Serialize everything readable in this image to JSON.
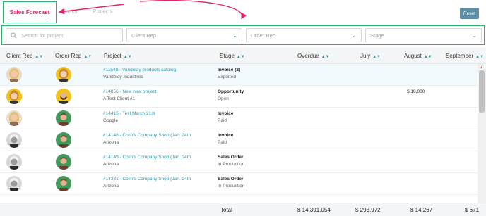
{
  "tabs": [
    {
      "label": "Sales Forecast",
      "active": true
    },
    {
      "label": "Tasks",
      "active": false
    },
    {
      "label": "Projects",
      "active": false
    }
  ],
  "reset_label": "Reset",
  "filters": {
    "search_placeholder": "Search for project",
    "client_rep": "Client Rep",
    "order_rep": "Order Rep",
    "stage": "Stage"
  },
  "columns": [
    "Client Rep",
    "Order Rep",
    "Project",
    "Stage",
    "Overdue",
    "July",
    "August",
    "September"
  ],
  "rows": [
    {
      "project": "#11548 - Vandelay products catalog",
      "client": "Vandelay Industries",
      "stage": "Invoice (2)",
      "status": "Exported",
      "overdue": "",
      "july": "",
      "august": "",
      "client_avatar": "woman-blonde",
      "order_avatar": "woman-yellow"
    },
    {
      "project": "#14856 - New new project",
      "client": "A Test Client #1",
      "stage": "Opportunity",
      "status": "Open",
      "overdue": "",
      "july": "",
      "august": "$ 10,000",
      "client_avatar": "woman-yellow",
      "order_avatar": "man-beard"
    },
    {
      "project": "#14415 - Test March 21st",
      "client": "Google",
      "stage": "Invoice",
      "status": "Paid",
      "overdue": "",
      "july": "",
      "august": "",
      "client_avatar": "woman-blonde",
      "order_avatar": "man-green"
    },
    {
      "project": "#14148 - Colin's Company Shop (Jan. 24th",
      "client": "Arizona",
      "stage": "Invoice",
      "status": "Paid",
      "overdue": "",
      "july": "",
      "august": "",
      "client_avatar": "man-bw",
      "order_avatar": "man-green"
    },
    {
      "project": "#14149 - Colin's Company Shop (Jan. 24th",
      "client": "Arizona",
      "stage": "Sales Order",
      "status": "In Production",
      "overdue": "",
      "july": "",
      "august": "",
      "client_avatar": "man-bw",
      "order_avatar": "man-green"
    },
    {
      "project": "#14381 - Colin's Company Shop (Jan. 24th",
      "client": "Arizona",
      "stage": "Sales Order",
      "status": "In Production",
      "overdue": "",
      "july": "",
      "august": "",
      "client_avatar": "man-bw",
      "order_avatar": "man-green"
    }
  ],
  "totals": {
    "label": "Total",
    "overdue": "$ 14,391,054",
    "july": "$ 293,972",
    "august": "$ 14,267",
    "september": "$ 671"
  },
  "colors": {
    "accent_pink": "#e0226e",
    "highlight_green": "#2db36b",
    "link_teal": "#2a9bb0",
    "reset_button": "#5a8fa7"
  }
}
